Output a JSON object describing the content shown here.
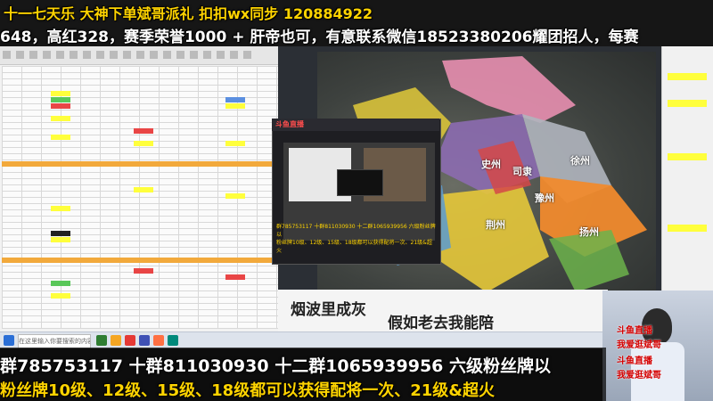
{
  "overlay": {
    "line1": "十一七天乐 大神下单斌哥派礼 扣扣wx同步 120884922",
    "line2": "648，高红328，赛季荣誉1000 + 肝帝也可，有意联系微信18523380206耀团招人，每赛",
    "line3": "群785753117   十群811030930 十二群1065939956 六级粉丝牌以",
    "line4": "粉丝牌10级、12级、15级、18级都可以获得配将一次、21级&超火"
  },
  "map": {
    "labels": [
      "史州",
      "司隶",
      "豫州",
      "荆州",
      "徐州",
      "扬州"
    ],
    "calligraphy_left": "烟波里成灰",
    "calligraphy_right": "假如老去我能陪"
  },
  "inner_window": {
    "title": "斗鱼直播",
    "line_a": "群785753117 十群811030930 十二群1065939956 六级粉丝牌以",
    "line_b": "粉丝牌10级、12级、15级、18级都可以获得配将一次、21级&超火"
  },
  "cam": {
    "lines": [
      "斗鱼直播",
      "我爱逛斌哥",
      "斗鱼直播",
      "我爱逛斌哥"
    ]
  },
  "taskbar": {
    "search": "在这里输入你要搜索的内容"
  },
  "colors": {
    "yellow": "#ffd400",
    "orange_header": "#f2a93b",
    "highlight_red": "#e94545",
    "highlight_yellow": "#ffff3c"
  }
}
